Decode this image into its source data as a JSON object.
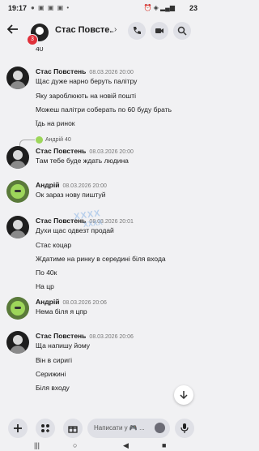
{
  "status": {
    "time": "19:17",
    "left_icons": "● ▣ ▣ ▣ •",
    "right_icons": "⏰ ◈ ▂▄▆",
    "battery": "23"
  },
  "header": {
    "title": "Стас Повсте...",
    "unread_badge": "3"
  },
  "chat": {
    "top_cut_text": "40",
    "groups": [
      {
        "author": "Стас Повстень",
        "time": "08.03.2026 20:00",
        "lines": [
          "Щас дуже нарно беруть палітру",
          "Яку зароблюють на новій пошті",
          "Можеш палітри соберать по 60 буду брать",
          "Їдь на ринок"
        ]
      },
      {
        "reply": {
          "author": "Андрій",
          "text": "40"
        },
        "author": "Стас Повстень",
        "time": "08.03.2026 20:00",
        "lines": [
          "Там тебе буде ждать людина"
        ]
      },
      {
        "author": "Андрій",
        "time": "08.03.2026 20:00",
        "lines": [
          "Ок зараз нову пиштуй"
        ]
      },
      {
        "author": "Стас Повстень",
        "time": "08.03.2026 20:01",
        "lines": [
          "Духи щас одвезт продай",
          "Стас коцар",
          "Ждатиме на ринку в середині біля входа",
          "По 40к",
          "На цр"
        ]
      },
      {
        "author": "Андрій",
        "time": "08.03.2026 20:06",
        "lines": [
          "Нема біля я цпр"
        ]
      },
      {
        "author": "Стас Повстень",
        "time": "08.03.2026 20:06",
        "lines": [
          "Ща напишу йому",
          "Він в сиригі",
          "Серижині",
          "Біля входу"
        ]
      }
    ],
    "sticker": {
      "line1": "XXXX",
      "line2": "XXXX"
    }
  },
  "composer": {
    "placeholder": "Написати у 🎮 ..."
  },
  "nav": {
    "menu": "|||",
    "home": "○",
    "back": "◀",
    "square": "■"
  }
}
